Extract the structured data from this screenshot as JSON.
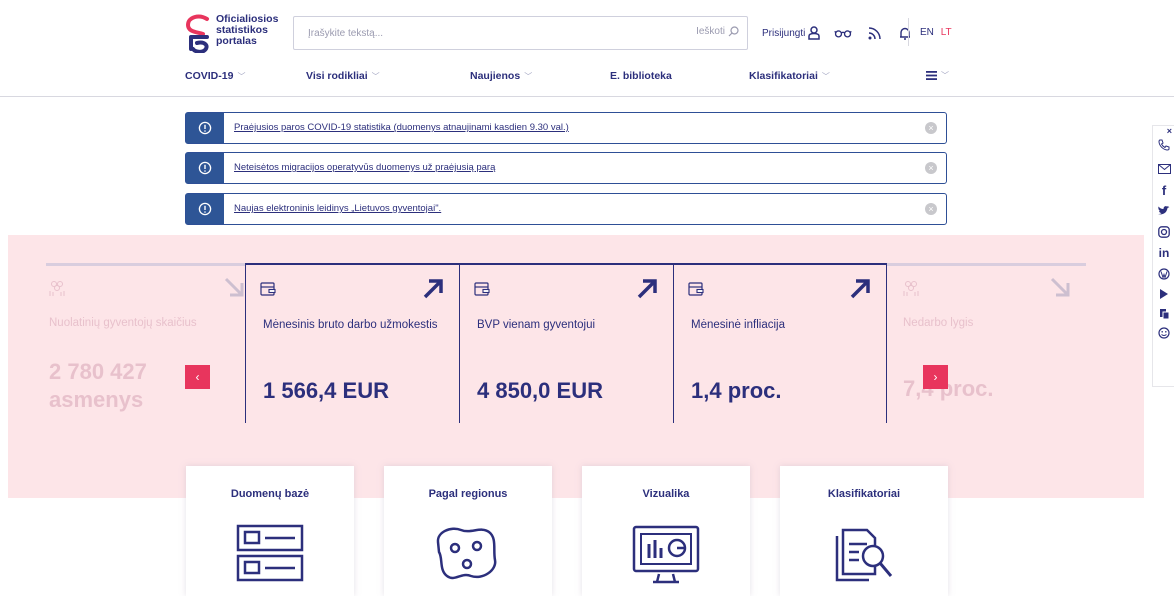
{
  "logo": {
    "line1": "Oficialiosios",
    "line2": "statistikos",
    "line3": "portalas"
  },
  "search": {
    "placeholder": "Įrašykite tekstą...",
    "button_label": "Ieškoti"
  },
  "tools": {
    "login_label": "Prisijungti",
    "lang_en": "EN",
    "lang_lt": "LT"
  },
  "nav": {
    "covid": "COVID-19",
    "indicators": "Visi rodikliai",
    "news": "Naujienos",
    "library": "E. biblioteka",
    "classifiers": "Klasifikatoriai"
  },
  "alerts": [
    {
      "text": "Praėjusios paros COVID-19 statistika (duomenys atnaujinami kasdien 9.30 val.)"
    },
    {
      "text": "Neteisėtos migracijos operatyvūs duomenys už praėjusią parą"
    },
    {
      "text": "Naujas elektroninis leidinys „Lietuvos gyventojai\"."
    }
  ],
  "stats": [
    {
      "title": "Nuolatinių gyventojų skaičius",
      "value_line1": "2 780 427",
      "value_line2": "asmenys",
      "trend": "down"
    },
    {
      "title": "Mėnesinis bruto darbo užmokestis",
      "value": "1 566,4 EUR",
      "trend": "up"
    },
    {
      "title": "BVP vienam gyventojui",
      "value": "4 850,0 EUR",
      "trend": "up"
    },
    {
      "title": "Mėnesinė infliacija",
      "value": "1,4 proc.",
      "trend": "up"
    },
    {
      "title": "Nedarbo lygis",
      "value": "7,4 proc.",
      "trend": "down"
    }
  ],
  "carousel": {
    "prev": "‹",
    "next": "›"
  },
  "tiles": [
    {
      "title": "Duomenų bazė"
    },
    {
      "title": "Pagal regionus"
    },
    {
      "title": "Vizualika"
    },
    {
      "title": "Klasifikatoriai"
    }
  ],
  "social": {
    "close": "×",
    "facebook": "f",
    "linkedin": "in"
  },
  "colors": {
    "brand_navy": "#2c2f7c",
    "accent_red": "#e8355d",
    "band_pink": "#fde5e8",
    "alert_blue": "#2e5596"
  }
}
